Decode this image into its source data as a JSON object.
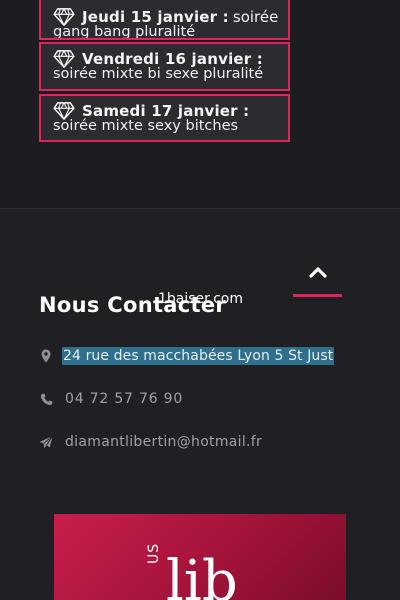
{
  "events": [
    {
      "date": "Jeudi 15 janvier :",
      "desc_inline": "soirée",
      "desc": "gang bang pluralité"
    },
    {
      "date": "Vendredi 16 janvier :",
      "desc_inline": "",
      "desc": "soirée mixte bi sexe pluralité"
    },
    {
      "date": "Samedi 17 janvier :",
      "desc_inline": "",
      "desc": "soirée mixte sexy bitches"
    }
  ],
  "contact": {
    "heading": "Nous Contacter",
    "address": "24 rue des macchabées Lyon 5 St Just",
    "phone": "04 72 57 76 90",
    "email": "diamantlibertin@hotmail.fr"
  },
  "watermark": "1baiser.com",
  "promo": {
    "side_text": "US",
    "big_text": "lib"
  },
  "icons": {
    "event": "diamond-icon",
    "scroll_top": "chevron-up-icon",
    "address": "map-marker-icon",
    "phone": "phone-icon",
    "email": "paper-plane-icon"
  },
  "colors": {
    "accent": "#e0245e",
    "background": "#1f1f24",
    "address_highlight": "#2f6f8c"
  }
}
